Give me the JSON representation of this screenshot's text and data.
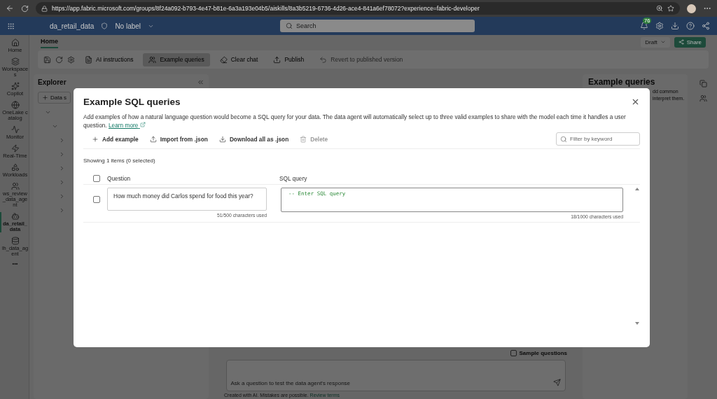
{
  "browser": {
    "url": "https://app.fabric.microsoft.com/groups/8f24a092-b793-4e47-b81e-6a3a193e04b5/aiskills/8a3b5219-6736-4d26-ace4-841a6ef78072?experience=fabric-developer"
  },
  "header": {
    "item_name": "da_retail_data",
    "label": "No label",
    "search_placeholder": "Search",
    "notification_count": "76"
  },
  "rail": [
    {
      "label": "Home",
      "selected": false
    },
    {
      "label": "Workspaces",
      "selected": false
    },
    {
      "label": "Copilot",
      "selected": false
    },
    {
      "label": "OneLake catalog",
      "selected": false
    },
    {
      "label": "Monitor",
      "selected": false
    },
    {
      "label": "Real-Time",
      "selected": false
    },
    {
      "label": "Workloads",
      "selected": false
    },
    {
      "label": "ws_review_data_agent",
      "selected": false
    },
    {
      "label": "da_retail_data",
      "selected": true
    },
    {
      "label": "lh_data_agent",
      "selected": false
    },
    {
      "label": "•••",
      "selected": false
    }
  ],
  "ribbon": {
    "tabs": [
      {
        "label": "Home",
        "selected": true
      }
    ],
    "buttons": [
      {
        "label": "AI instructions",
        "disabled": false,
        "pressed": false
      },
      {
        "label": "Example queries",
        "disabled": false,
        "pressed": true
      },
      {
        "label": "Clear chat",
        "disabled": false,
        "pressed": false
      },
      {
        "label": "Publish",
        "disabled": false,
        "pressed": false
      },
      {
        "label": "Revert to published version",
        "disabled": true,
        "pressed": false
      }
    ],
    "draft": "Draft",
    "share": "Share"
  },
  "explorer": {
    "title": "Explorer",
    "add_button": "Data s"
  },
  "side_panel": {
    "title": "Example queries",
    "lines": [
      "dd common",
      "interpret them."
    ]
  },
  "chat": {
    "sample_questions": {
      "label": "Sample questions",
      "checked": false
    },
    "placeholder": "Ask a question to test the data agent's response",
    "footer": "Created with AI. Mistakes are possible.",
    "footer_link": "Review terms"
  },
  "dialog": {
    "title": "Example SQL queries",
    "description": "Add examples of how a natural language question would become a SQL query for your data. The data agent will automatically select up to three valid examples to share with the model each time it handles a user question.",
    "learn_more": "Learn more",
    "actions": [
      {
        "label": "Add example",
        "disabled": false
      },
      {
        "label": "Import from .json",
        "disabled": false
      },
      {
        "label": "Download all as .json",
        "disabled": false
      },
      {
        "label": "Delete",
        "disabled": true
      }
    ],
    "filter_placeholder": "Filter by keyword",
    "summary": "Showing 1 items (0 selected)",
    "columns": [
      "Question",
      "SQL query"
    ],
    "select_all": {
      "checked": false
    },
    "rows": [
      {
        "checked": false,
        "question": "How much money did Carlos spend for food this year?",
        "question_count": "51/500 characters used",
        "sql": "-- Enter SQL query",
        "sql_count": "18/1000 characters used"
      }
    ]
  }
}
